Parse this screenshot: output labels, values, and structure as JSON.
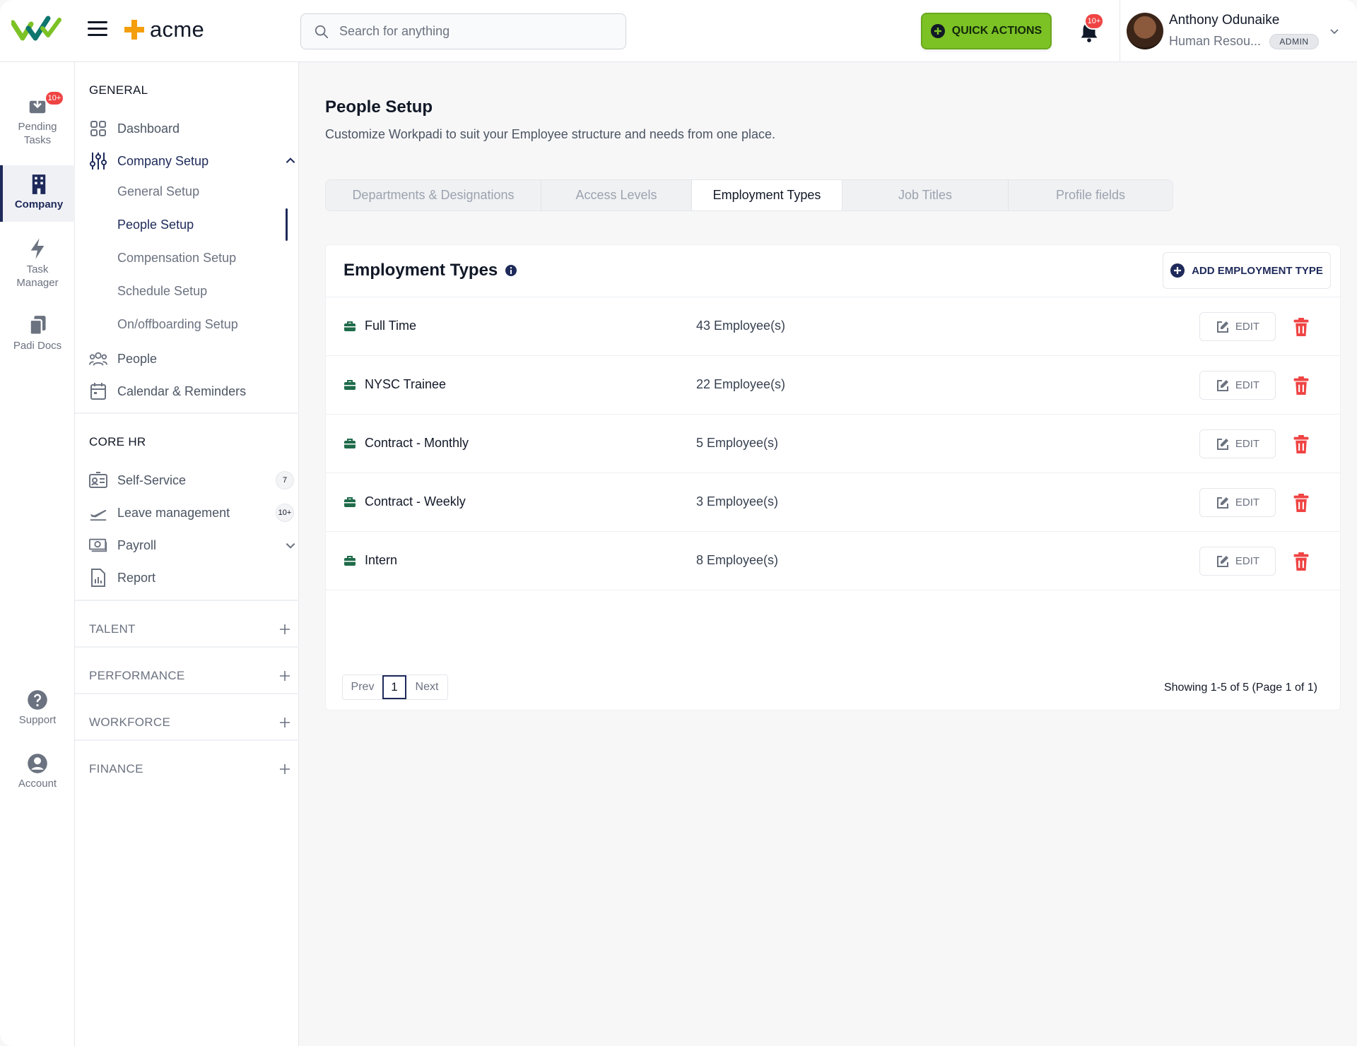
{
  "header": {
    "brand": "acme",
    "search_placeholder": "Search for anything",
    "quick_actions": "QUICK ACTIONS",
    "notifications_badge": "10+",
    "user_name": "Anthony Odunaike",
    "user_role": "Human Resou...",
    "user_badge": "ADMIN"
  },
  "rail": {
    "pending_badge": "10+",
    "pending_line1": "Pending",
    "pending_line2": "Tasks",
    "company": "Company",
    "task_line1": "Task",
    "task_line2": "Manager",
    "padi_docs": "Padi Docs",
    "support": "Support",
    "account": "Account"
  },
  "sidebar": {
    "general": "GENERAL",
    "dashboard": "Dashboard",
    "company_setup": "Company Setup",
    "general_setup": "General Setup",
    "people_setup": "People Setup",
    "compensation_setup": "Compensation Setup",
    "schedule_setup": "Schedule Setup",
    "onoff_setup": "On/offboarding Setup",
    "people": "People",
    "calendar": "Calendar & Reminders",
    "core_hr": "CORE HR",
    "self_service": "Self-Service",
    "self_service_count": "7",
    "leave": "Leave management",
    "leave_count": "10+",
    "payroll": "Payroll",
    "report": "Report",
    "talent": "TALENT",
    "performance": "PERFORMANCE",
    "workforce": "WORKFORCE",
    "finance": "FINANCE"
  },
  "main": {
    "title": "People Setup",
    "subtitle": "Customize Workpadi to suit your Employee structure and needs from one place.",
    "tabs": [
      {
        "label": "Departments & Designations"
      },
      {
        "label": "Access Levels"
      },
      {
        "label": "Employment Types"
      },
      {
        "label": "Job Titles"
      },
      {
        "label": "Profile fields"
      }
    ],
    "active_tab": "Employment Types",
    "card_title": "Employment Types",
    "add_button": "ADD EMPLOYMENT TYPE",
    "edit_label": "EDIT",
    "rows": [
      {
        "name": "Full Time",
        "count": "43 Employee(s)"
      },
      {
        "name": "NYSC Trainee",
        "count": "22 Employee(s)"
      },
      {
        "name": "Contract - Monthly",
        "count": "5 Employee(s)"
      },
      {
        "name": "Contract - Weekly",
        "count": "3 Employee(s)"
      },
      {
        "name": "Intern",
        "count": "8 Employee(s)"
      }
    ],
    "pager": {
      "prev": "Prev",
      "page": "1",
      "next": "Next"
    },
    "showing": "Showing 1-5 of 5 (Page 1 of 1)"
  },
  "colors": {
    "brand_navy": "#1e2a5a",
    "quick_green": "#7cc225",
    "danger": "#ef4444",
    "briefcase": "#1f6b4a"
  }
}
